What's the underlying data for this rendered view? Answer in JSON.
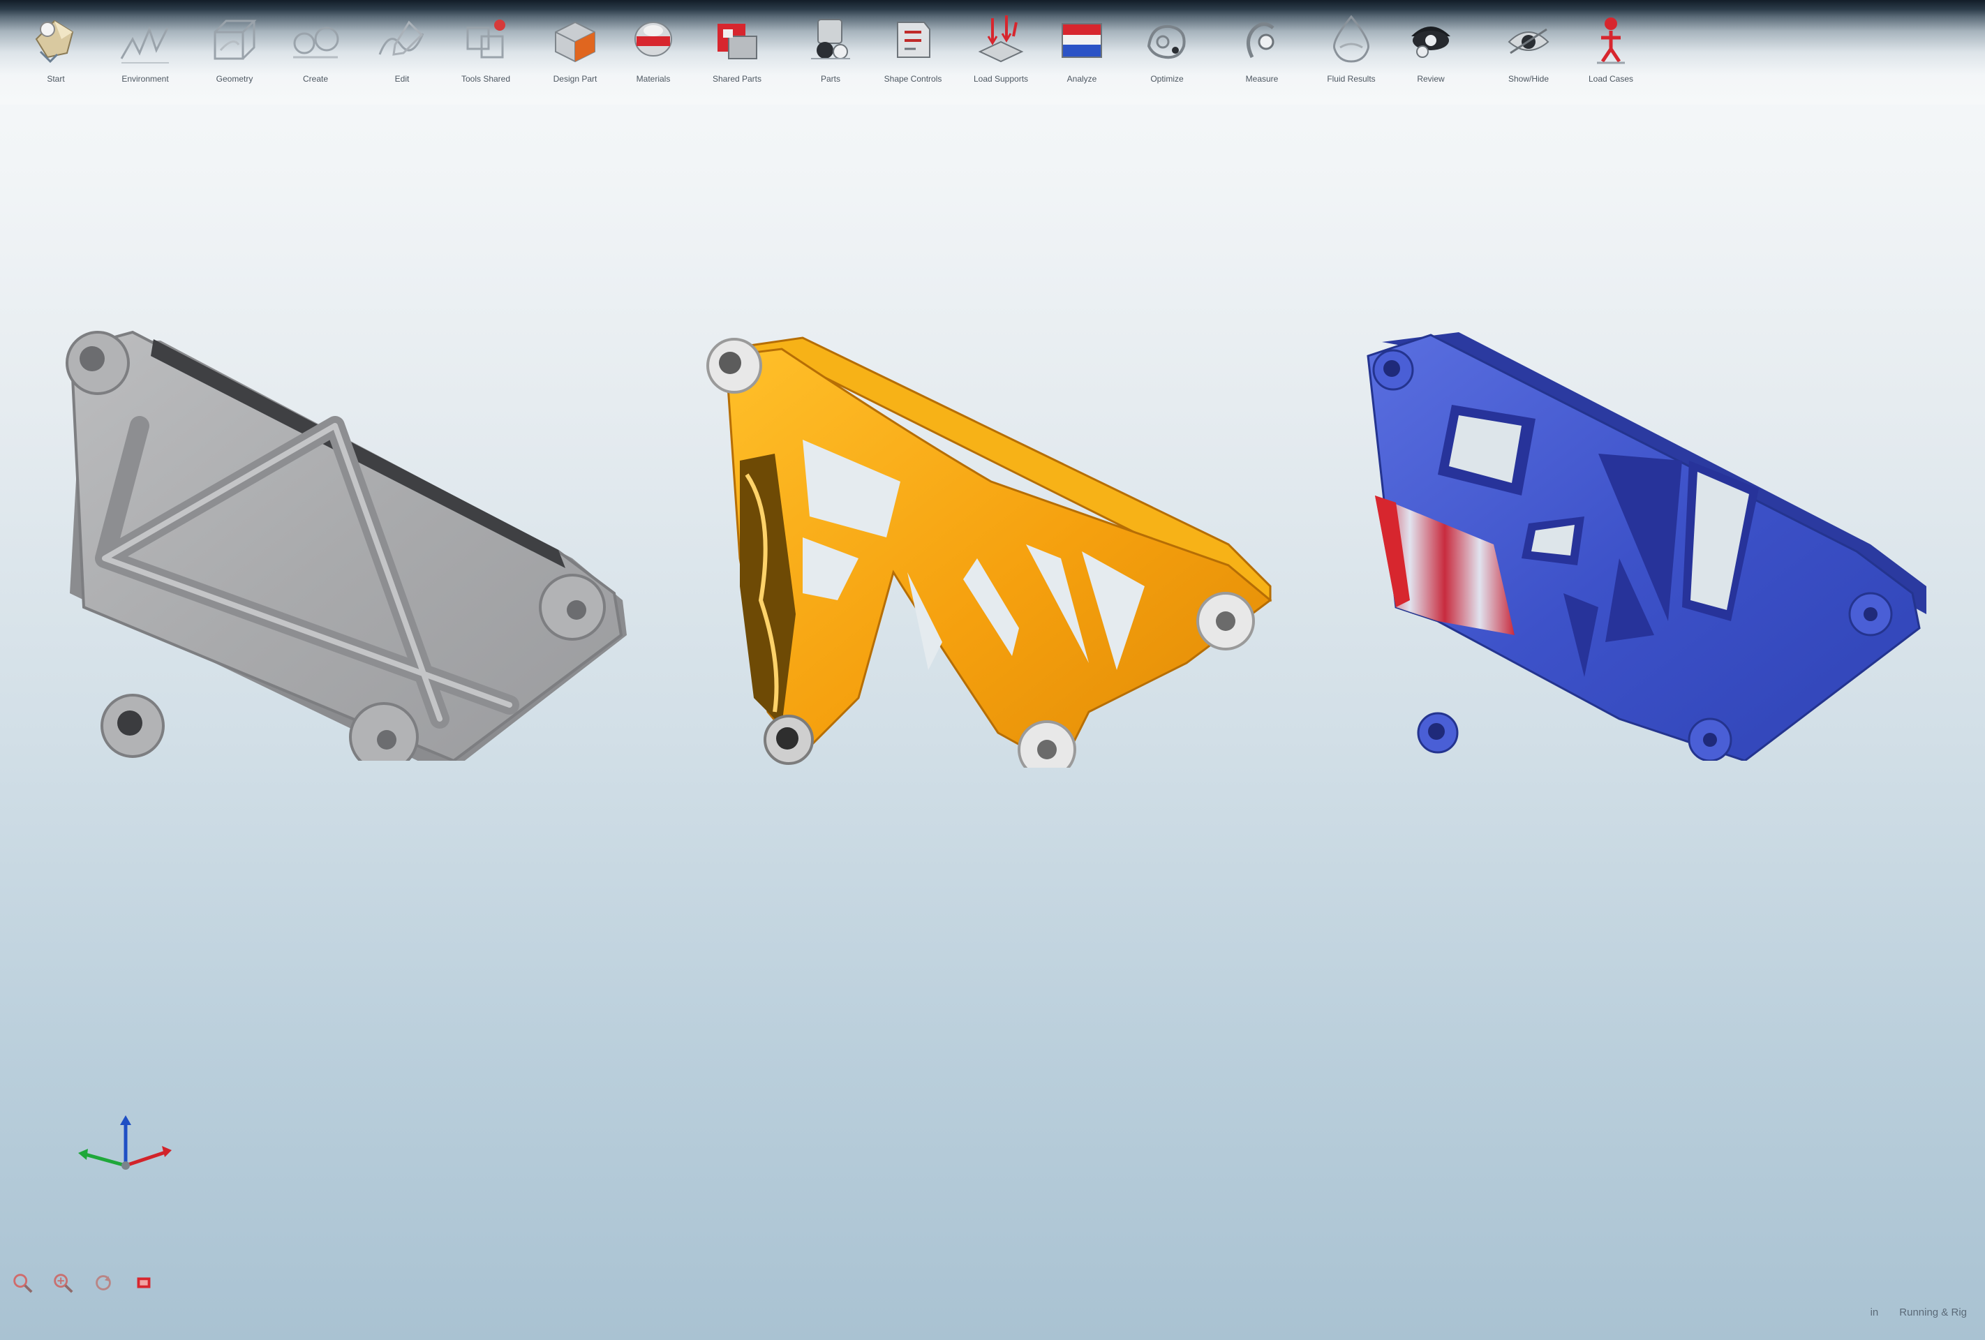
{
  "toolbar": {
    "tools": [
      {
        "label": "Start",
        "icon": "start-icon"
      },
      {
        "label": "Environment",
        "icon": "sketch-line-icon"
      },
      {
        "label": "Geometry",
        "icon": "geometry-icon"
      },
      {
        "label": "Create",
        "icon": "create-icon"
      },
      {
        "label": "Edit",
        "icon": "edit-icon"
      },
      {
        "label": "Tools Shared",
        "icon": "tools-shared-icon"
      },
      {
        "label": "Design Part",
        "icon": "design-part-icon"
      },
      {
        "label": "Materials",
        "icon": "materials-icon"
      },
      {
        "label": "Shared Parts",
        "icon": "shared-parts-icon"
      },
      {
        "label": "Parts",
        "icon": "parts-icon"
      },
      {
        "label": "Shape Controls",
        "icon": "shape-controls-icon"
      },
      {
        "label": "Load Supports",
        "icon": "load-supports-icon"
      },
      {
        "label": "Analyze",
        "icon": "analyze-icon"
      },
      {
        "label": "Optimize",
        "icon": "optimize-icon"
      },
      {
        "label": "Measure",
        "icon": "measure-icon"
      },
      {
        "label": "Fluid Results",
        "icon": "fluid-results-icon"
      },
      {
        "label": "Review",
        "icon": "review-icon"
      },
      {
        "label": "Show/Hide",
        "icon": "show-hide-icon"
      },
      {
        "label": "Load Cases",
        "icon": "load-cases-icon"
      }
    ]
  },
  "viewport": {
    "parts": [
      {
        "name": "design-space-part",
        "color": "#a9aaac"
      },
      {
        "name": "optimized-part",
        "color": "#f5a00e"
      },
      {
        "name": "analysis-result-part",
        "color": "#3d52c9"
      }
    ],
    "axis_colors": {
      "x": "#d2232a",
      "y": "#1fa83a",
      "z": "#1f4fc4"
    },
    "view_controls": [
      {
        "icon": "zoom-fit-icon"
      },
      {
        "icon": "zoom-window-icon"
      },
      {
        "icon": "rotate-view-icon"
      },
      {
        "icon": "render-mode-icon"
      }
    ],
    "status": {
      "unit_text": "in",
      "mode_text": "Running & Rig"
    }
  }
}
